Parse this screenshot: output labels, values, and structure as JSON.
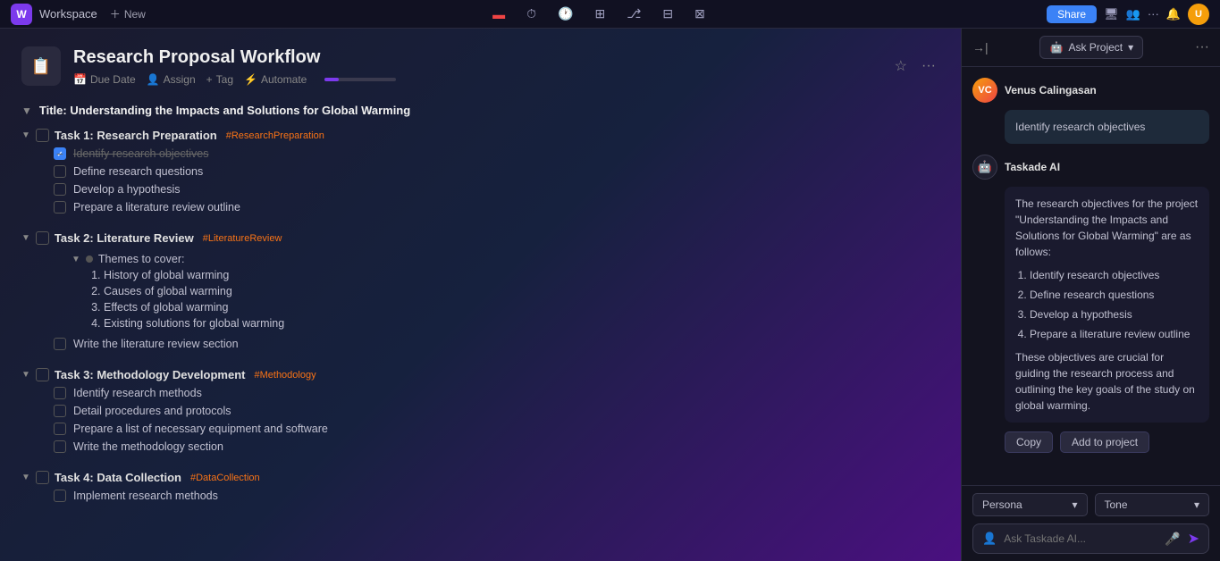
{
  "app": {
    "name": "Workspace",
    "logo": "W",
    "new_label": "New"
  },
  "nav": {
    "share_label": "Share",
    "ask_project_label": "Ask Project"
  },
  "project": {
    "icon": "📋",
    "title": "Research Proposal Workflow",
    "star_icon": "★",
    "more_icon": "···",
    "actions": [
      {
        "label": "Due Date",
        "icon": "📅"
      },
      {
        "label": "Assign",
        "icon": "👤"
      },
      {
        "label": "Tag",
        "icon": "+"
      },
      {
        "label": "Automate",
        "icon": "⚡"
      }
    ]
  },
  "task_list": {
    "section_title": "Title: Understanding the Impacts and Solutions for Global Warming",
    "tasks": [
      {
        "id": "task1",
        "label": "Task 1: Research Preparation",
        "tag": "#ResearchPreparation",
        "subtasks": [
          {
            "label": "Identify research objectives",
            "checked": true
          },
          {
            "label": "Define research questions",
            "checked": false
          },
          {
            "label": "Develop a hypothesis",
            "checked": false
          },
          {
            "label": "Prepare a literature review outline",
            "checked": false
          }
        ]
      },
      {
        "id": "task2",
        "label": "Task 2: Literature Review",
        "tag": "#LiteratureReview",
        "nested": {
          "header": "Themes to cover:",
          "items": [
            "History of global warming",
            "Causes of global warming",
            "Effects of global warming",
            "Existing solutions for global warming"
          ]
        },
        "subtasks": [
          {
            "label": "Write the literature review section",
            "checked": false
          }
        ]
      },
      {
        "id": "task3",
        "label": "Task 3: Methodology Development",
        "tag": "#Methodology",
        "subtasks": [
          {
            "label": "Identify research methods",
            "checked": false
          },
          {
            "label": "Detail procedures and protocols",
            "checked": false
          },
          {
            "label": "Prepare a list of necessary equipment and software",
            "checked": false
          },
          {
            "label": "Write the methodology section",
            "checked": false
          }
        ]
      },
      {
        "id": "task4",
        "label": "Task 4: Data Collection",
        "tag": "#DataCollection",
        "subtasks": [
          {
            "label": "Implement research methods",
            "checked": false
          }
        ]
      }
    ]
  },
  "ai_panel": {
    "title": "Ask Project",
    "three_dots": "···",
    "messages": [
      {
        "sender": "Venus Calingasan",
        "type": "human",
        "initials": "VC",
        "text": "Identify research objectives"
      },
      {
        "sender": "Taskade AI",
        "type": "ai",
        "icon": "🤖",
        "text": "The research objectives for the project \"Understanding the Impacts and Solutions for Global Warming\" are as follows:",
        "list": [
          "Identify research objectives",
          "Define research questions",
          "Develop a hypothesis",
          "Prepare a literature review outline"
        ],
        "footer": "These objectives are crucial for guiding the research process and outlining the key goals of the study on global warming."
      }
    ],
    "copy_label": "Copy",
    "add_to_project_label": "Add to project",
    "persona_label": "Persona",
    "tone_label": "Tone",
    "input_placeholder": "Ask Taskade AI..."
  }
}
